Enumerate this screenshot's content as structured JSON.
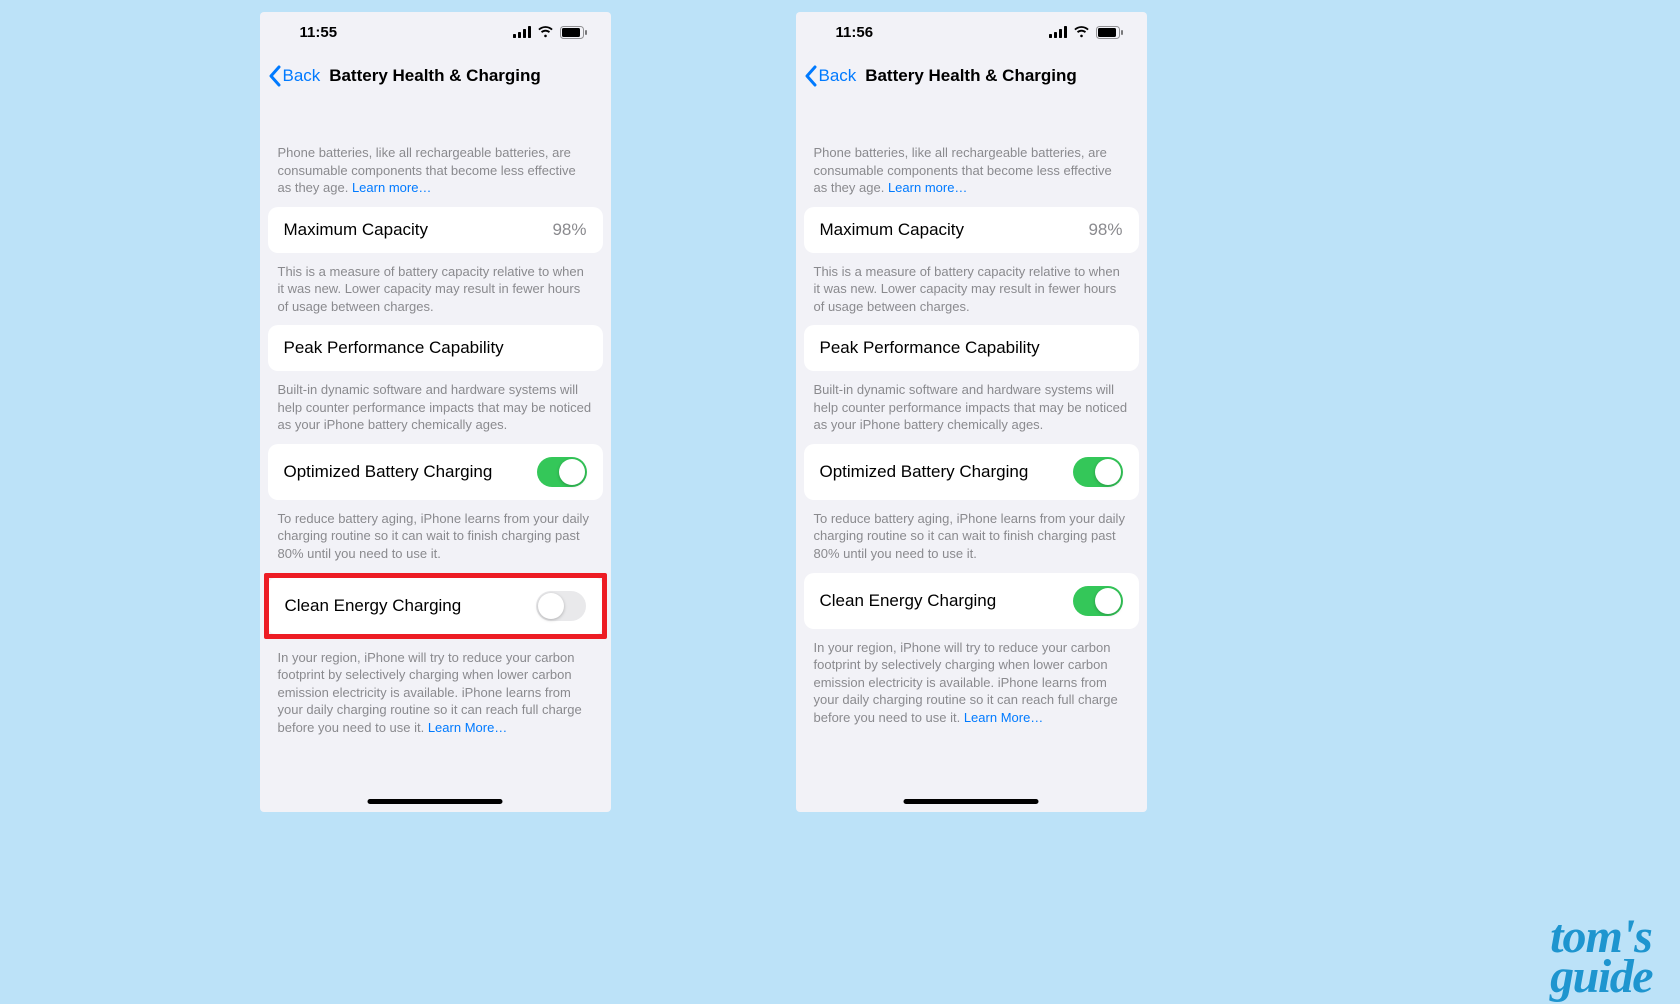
{
  "watermark": {
    "line1": "tom's",
    "line2": "guide"
  },
  "common": {
    "back_label": "Back",
    "title": "Battery Health & Charging",
    "intro_text": "Phone batteries, like all rechargeable batteries, are consumable components that become less effective as they age. ",
    "learn_more": "Learn more…",
    "max_capacity_label": "Maximum Capacity",
    "max_capacity_value": "98%",
    "max_capacity_desc": "This is a measure of battery capacity relative to when it was new. Lower capacity may result in fewer hours of usage between charges.",
    "peak_label": "Peak Performance Capability",
    "peak_desc": "Built-in dynamic software and hardware systems will help counter performance impacts that may be noticed as your iPhone battery chemically ages.",
    "optimized_label": "Optimized Battery Charging",
    "optimized_desc": "To reduce battery aging, iPhone learns from your daily charging routine so it can wait to finish charging past 80% until you need to use it.",
    "clean_label": "Clean Energy Charging",
    "clean_desc": "In your region, iPhone will try to reduce your carbon footprint by selectively charging when lower carbon emission electricity is available. iPhone learns from your daily charging routine so it can reach full charge before you need to use it. ",
    "learn_more2": "Learn More…"
  },
  "screens": [
    {
      "time": "11:55",
      "optimized_on": true,
      "clean_on": false,
      "highlight_clean": true
    },
    {
      "time": "11:56",
      "optimized_on": true,
      "clean_on": true,
      "highlight_clean": false
    }
  ]
}
